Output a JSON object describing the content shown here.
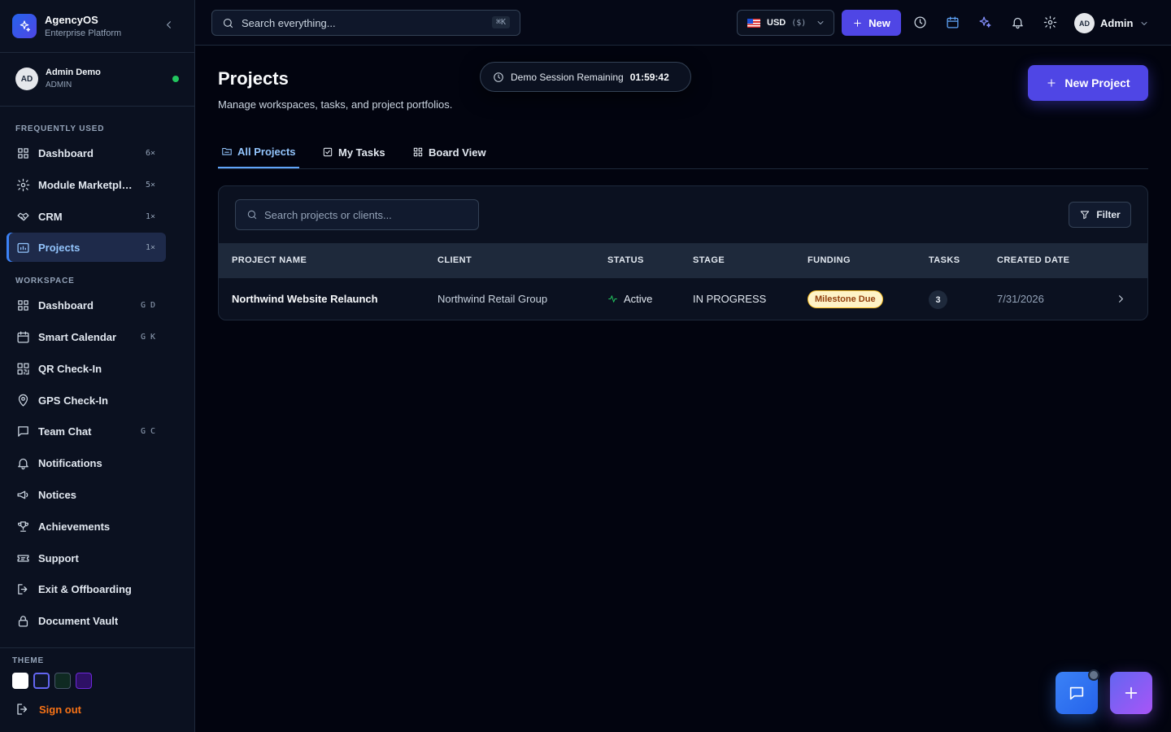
{
  "brand": {
    "name": "AgencyOS",
    "subtitle": "Enterprise Platform"
  },
  "user": {
    "initials": "AD",
    "name": "Admin Demo",
    "role": "ADMIN",
    "online_color": "#22c55e"
  },
  "sidebar": {
    "frequent_label": "FREQUENTLY USED",
    "frequent": [
      {
        "label": "Dashboard",
        "count": "6×",
        "icon": "grid-icon"
      },
      {
        "label": "Module Marketplace",
        "count": "5×",
        "icon": "gear-icon"
      },
      {
        "label": "CRM",
        "count": "1×",
        "icon": "handshake-icon"
      },
      {
        "label": "Projects",
        "count": "1×",
        "icon": "folder-chart-icon",
        "active": true
      }
    ],
    "workspace_label": "WORKSPACE",
    "workspace": [
      {
        "label": "Dashboard",
        "shortcut": "G D",
        "icon": "grid-icon"
      },
      {
        "label": "Smart Calendar",
        "shortcut": "G K",
        "icon": "calendar-icon"
      },
      {
        "label": "QR Check-In",
        "shortcut": "",
        "icon": "qr-icon"
      },
      {
        "label": "GPS Check-In",
        "shortcut": "",
        "icon": "map-pin-icon"
      },
      {
        "label": "Team Chat",
        "shortcut": "G C",
        "icon": "chat-icon"
      },
      {
        "label": "Notifications",
        "shortcut": "",
        "icon": "bell-icon"
      },
      {
        "label": "Notices",
        "shortcut": "",
        "icon": "megaphone-icon"
      },
      {
        "label": "Achievements",
        "shortcut": "",
        "icon": "trophy-icon"
      },
      {
        "label": "Support",
        "shortcut": "",
        "icon": "ticket-icon"
      },
      {
        "label": "Exit & Offboarding",
        "shortcut": "",
        "icon": "exit-icon"
      },
      {
        "label": "Document Vault",
        "shortcut": "",
        "icon": "lock-icon"
      }
    ],
    "theme_label": "THEME",
    "themes": [
      "#ffffff",
      "#0f172a",
      "#0f2a22",
      "#2e1065"
    ],
    "signout_label": "Sign out"
  },
  "topbar": {
    "search_placeholder": "Search everything...",
    "search_shortcut": "⌘K",
    "currency_code": "USD",
    "currency_symbol": "($)",
    "new_label": "New",
    "profile_initials": "AD",
    "profile_name": "Admin"
  },
  "page": {
    "title": "Projects",
    "subtitle": "Manage workspaces, tasks, and project portfolios.",
    "session_label": "Demo Session Remaining",
    "session_time": "01:59:42",
    "new_project_label": "New Project",
    "tabs": [
      {
        "label": "All Projects",
        "active": true
      },
      {
        "label": "My Tasks"
      },
      {
        "label": "Board View"
      }
    ]
  },
  "table": {
    "search_placeholder": "Search projects or clients...",
    "filter_label": "Filter",
    "columns": [
      "PROJECT NAME",
      "CLIENT",
      "STATUS",
      "STAGE",
      "FUNDING",
      "TASKS",
      "CREATED DATE"
    ],
    "rows": [
      {
        "name": "Northwind Website Relaunch",
        "client": "Northwind Retail Group",
        "status": "Active",
        "stage": "IN PROGRESS",
        "funding": "Milestone Due",
        "tasks": "3",
        "created": "7/31/2026"
      }
    ]
  },
  "colors": {
    "accent": "#4f46e5",
    "active_nav": "#93c5fd",
    "status_active": "#22c55e",
    "badge_warn_bg": "#fef3c7"
  }
}
